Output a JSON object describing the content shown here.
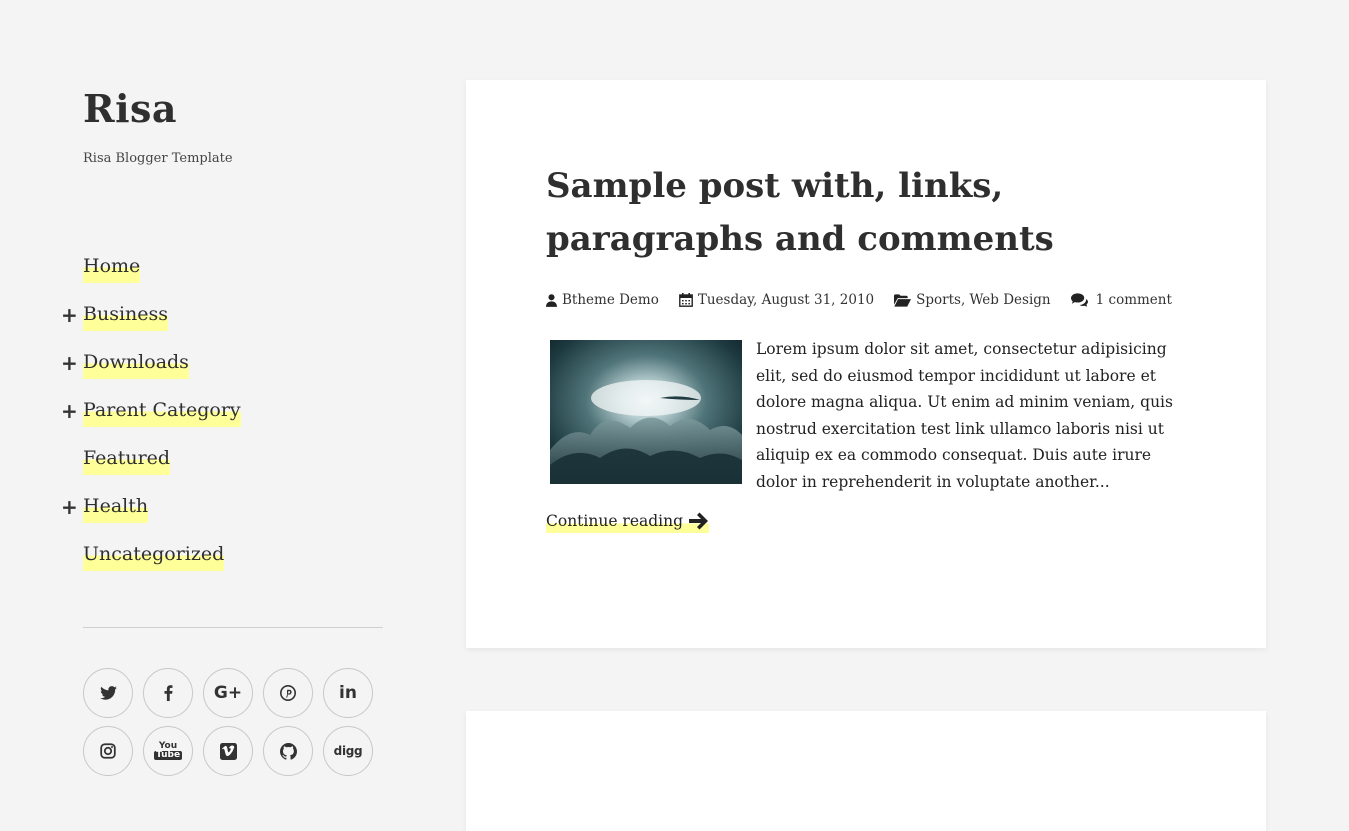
{
  "site": {
    "title": "Risa",
    "description": "Risa Blogger Template"
  },
  "nav": {
    "items": [
      {
        "label": "Home",
        "expandable": false
      },
      {
        "label": "Business",
        "expandable": true
      },
      {
        "label": "Downloads",
        "expandable": true
      },
      {
        "label": "Parent Category",
        "expandable": true
      },
      {
        "label": "Featured",
        "expandable": false
      },
      {
        "label": "Health",
        "expandable": true
      },
      {
        "label": "Uncategorized",
        "expandable": false
      }
    ],
    "expand_symbol": "+"
  },
  "social": {
    "icons": [
      "twitter-icon",
      "facebook-icon",
      "google-plus-icon",
      "pinterest-icon",
      "linkedin-icon",
      "instagram-icon",
      "youtube-icon",
      "vimeo-icon",
      "github-icon",
      "digg-icon"
    ],
    "glyphs": {
      "google_plus": "G+",
      "linkedin": "in",
      "digg": "digg",
      "youtube_top": "You",
      "youtube_bottom": "Tube"
    }
  },
  "post": {
    "title": "Sample post with, links, paragraphs and comments",
    "author": "Btheme Demo",
    "date": "Tuesday, August 31, 2010",
    "categories": "Sports, Web Design",
    "comments": "1 comment",
    "excerpt": "Lorem ipsum dolor sit amet, consectetur adipisicing elit, sed do eiusmod tempor incididunt ut labore et dolore magna aliqua. Ut enim ad minim veniam, quis nostrud exercitation test link ullamco laboris nisi ut aliquip ex ea commodo consequat. Duis aute irure dolor in reprehenderit in voluptate another...",
    "continue_label": "Continue reading"
  },
  "colors": {
    "background": "#f4f4f4",
    "card": "#ffffff",
    "highlight": "#ffff99",
    "text": "#2f2f2f"
  }
}
